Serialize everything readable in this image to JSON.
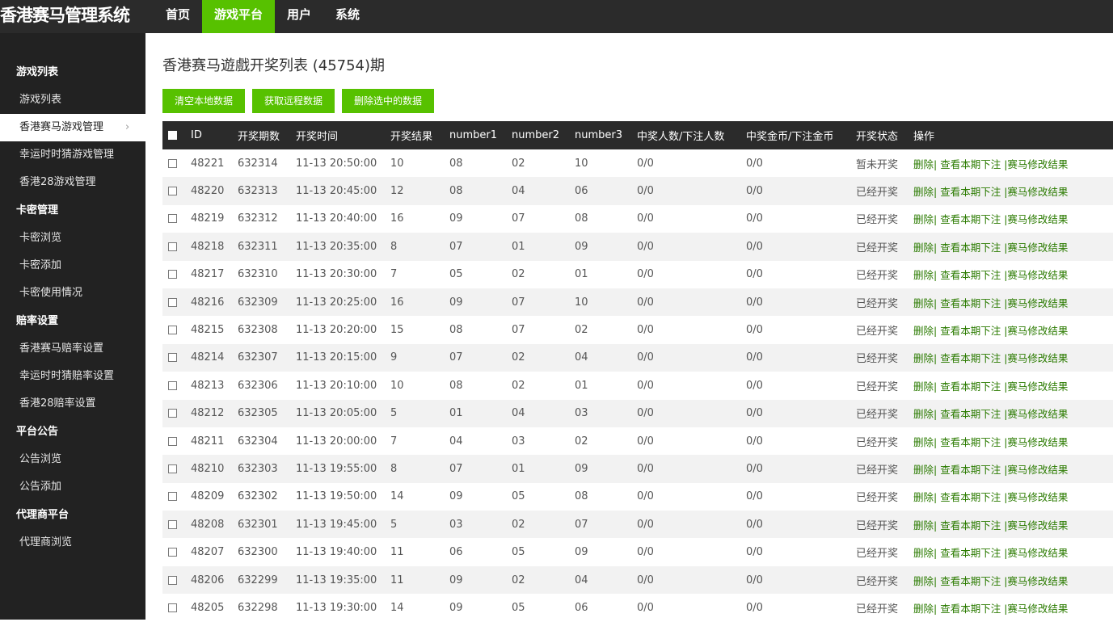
{
  "app": {
    "title": "香港赛马管理系统"
  },
  "topnav": [
    {
      "label": "首页",
      "active": false
    },
    {
      "label": "游戏平台",
      "active": true
    },
    {
      "label": "用户",
      "active": false
    },
    {
      "label": "系统",
      "active": false
    }
  ],
  "sidebar": [
    {
      "type": "group",
      "label": "游戏列表"
    },
    {
      "type": "item",
      "label": "游戏列表"
    },
    {
      "type": "item",
      "label": "香港赛马游戏管理",
      "active": true
    },
    {
      "type": "item",
      "label": "幸运时时猜游戏管理"
    },
    {
      "type": "item",
      "label": "香港28游戏管理"
    },
    {
      "type": "group",
      "label": "卡密管理"
    },
    {
      "type": "item",
      "label": "卡密浏览"
    },
    {
      "type": "item",
      "label": "卡密添加"
    },
    {
      "type": "item",
      "label": "卡密使用情况"
    },
    {
      "type": "group",
      "label": "赔率设置"
    },
    {
      "type": "item",
      "label": "香港赛马赔率设置"
    },
    {
      "type": "item",
      "label": "幸运时时猜赔率设置"
    },
    {
      "type": "item",
      "label": "香港28赔率设置"
    },
    {
      "type": "group",
      "label": "平台公告"
    },
    {
      "type": "item",
      "label": "公告浏览"
    },
    {
      "type": "item",
      "label": "公告添加"
    },
    {
      "type": "group",
      "label": "代理商平台"
    },
    {
      "type": "item",
      "label": "代理商浏览"
    }
  ],
  "page": {
    "title": "香港赛马遊戲开奖列表 (45754)期",
    "buttons": [
      "清空本地数据",
      "获取远程数据",
      "删除选中的数据"
    ]
  },
  "table": {
    "headers": [
      "ID",
      "开奖期数",
      "开奖时间",
      "开奖结果",
      "number1",
      "number2",
      "number3",
      "中奖人数/下注人数",
      "中奖金币/下注金币",
      "开奖状态",
      "操作"
    ],
    "op_delete": "删除|",
    "op_view": "查看本期下注",
    "op_edit": "|赛马修改结果",
    "rows": [
      [
        "48221",
        "632314",
        "11-13 20:50:00",
        "10",
        "08",
        "02",
        "10",
        "0/0",
        "0/0",
        "暂未开奖"
      ],
      [
        "48220",
        "632313",
        "11-13 20:45:00",
        "12",
        "08",
        "04",
        "06",
        "0/0",
        "0/0",
        "已经开奖"
      ],
      [
        "48219",
        "632312",
        "11-13 20:40:00",
        "16",
        "09",
        "07",
        "08",
        "0/0",
        "0/0",
        "已经开奖"
      ],
      [
        "48218",
        "632311",
        "11-13 20:35:00",
        "8",
        "07",
        "01",
        "09",
        "0/0",
        "0/0",
        "已经开奖"
      ],
      [
        "48217",
        "632310",
        "11-13 20:30:00",
        "7",
        "05",
        "02",
        "01",
        "0/0",
        "0/0",
        "已经开奖"
      ],
      [
        "48216",
        "632309",
        "11-13 20:25:00",
        "16",
        "09",
        "07",
        "10",
        "0/0",
        "0/0",
        "已经开奖"
      ],
      [
        "48215",
        "632308",
        "11-13 20:20:00",
        "15",
        "08",
        "07",
        "02",
        "0/0",
        "0/0",
        "已经开奖"
      ],
      [
        "48214",
        "632307",
        "11-13 20:15:00",
        "9",
        "07",
        "02",
        "04",
        "0/0",
        "0/0",
        "已经开奖"
      ],
      [
        "48213",
        "632306",
        "11-13 20:10:00",
        "10",
        "08",
        "02",
        "01",
        "0/0",
        "0/0",
        "已经开奖"
      ],
      [
        "48212",
        "632305",
        "11-13 20:05:00",
        "5",
        "01",
        "04",
        "03",
        "0/0",
        "0/0",
        "已经开奖"
      ],
      [
        "48211",
        "632304",
        "11-13 20:00:00",
        "7",
        "04",
        "03",
        "02",
        "0/0",
        "0/0",
        "已经开奖"
      ],
      [
        "48210",
        "632303",
        "11-13 19:55:00",
        "8",
        "07",
        "01",
        "09",
        "0/0",
        "0/0",
        "已经开奖"
      ],
      [
        "48209",
        "632302",
        "11-13 19:50:00",
        "14",
        "09",
        "05",
        "08",
        "0/0",
        "0/0",
        "已经开奖"
      ],
      [
        "48208",
        "632301",
        "11-13 19:45:00",
        "5",
        "03",
        "02",
        "07",
        "0/0",
        "0/0",
        "已经开奖"
      ],
      [
        "48207",
        "632300",
        "11-13 19:40:00",
        "11",
        "06",
        "05",
        "09",
        "0/0",
        "0/0",
        "已经开奖"
      ],
      [
        "48206",
        "632299",
        "11-13 19:35:00",
        "11",
        "09",
        "02",
        "04",
        "0/0",
        "0/0",
        "已经开奖"
      ],
      [
        "48205",
        "632298",
        "11-13 19:30:00",
        "14",
        "09",
        "05",
        "06",
        "0/0",
        "0/0",
        "已经开奖"
      ]
    ]
  },
  "colors": {
    "accent": "#57c100",
    "dark": "#2b2b2b",
    "sidebar": "#222222",
    "link": "#2b7b00"
  }
}
